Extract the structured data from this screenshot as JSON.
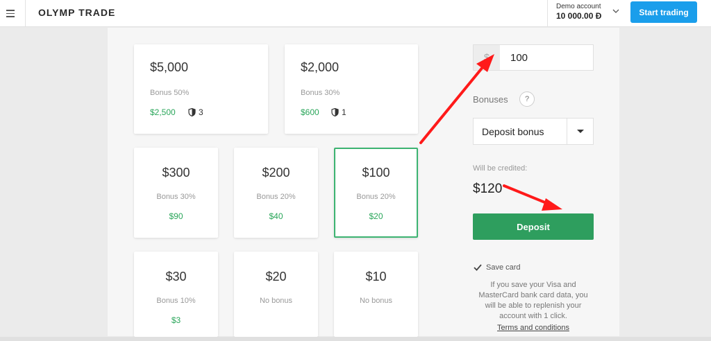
{
  "header": {
    "logo": "OLYMP TRADE",
    "account_label": "Demo account",
    "account_balance": "10 000.00 Đ",
    "start_button": "Start trading"
  },
  "cards_large": [
    {
      "amount": "$5,000",
      "bonus": "Bonus 50%",
      "extra": "$2,500",
      "risk_free": "3"
    },
    {
      "amount": "$2,000",
      "bonus": "Bonus 30%",
      "extra": "$600",
      "risk_free": "1"
    }
  ],
  "cards_small": [
    {
      "amount": "$300",
      "bonus": "Bonus 30%",
      "extra": "$90"
    },
    {
      "amount": "$200",
      "bonus": "Bonus 20%",
      "extra": "$40"
    },
    {
      "amount": "$100",
      "bonus": "Bonus 20%",
      "extra": "$20",
      "selected": true
    },
    {
      "amount": "$30",
      "bonus": "Bonus 10%",
      "extra": "$3"
    },
    {
      "amount": "$20",
      "bonus": "No bonus",
      "extra": ""
    },
    {
      "amount": "$10",
      "bonus": "No bonus",
      "extra": ""
    }
  ],
  "form": {
    "currency_symbol": "$",
    "amount_value": "100",
    "bonuses_label": "Bonuses",
    "help_symbol": "?",
    "bonus_option": "Deposit bonus",
    "credited_label": "Will be credited:",
    "credited_value": "$120",
    "deposit_button": "Deposit",
    "save_card_label": "Save card",
    "save_card_checked": true,
    "save_card_note": "If you save your Visa and MasterCard bank card data, you will be able to replenish your account with 1 click.",
    "terms_link": "Terms and conditions"
  },
  "colors": {
    "accent_blue": "#1a9eeb",
    "green": "#2e9e5e",
    "selected_border": "#3cb371",
    "annotation_red": "#ff1a1a"
  },
  "icons": [
    "menu-icon",
    "chevron-down-icon",
    "shield-icon",
    "caret-down-icon",
    "checkmark-icon",
    "red-arrow-annotation"
  ]
}
